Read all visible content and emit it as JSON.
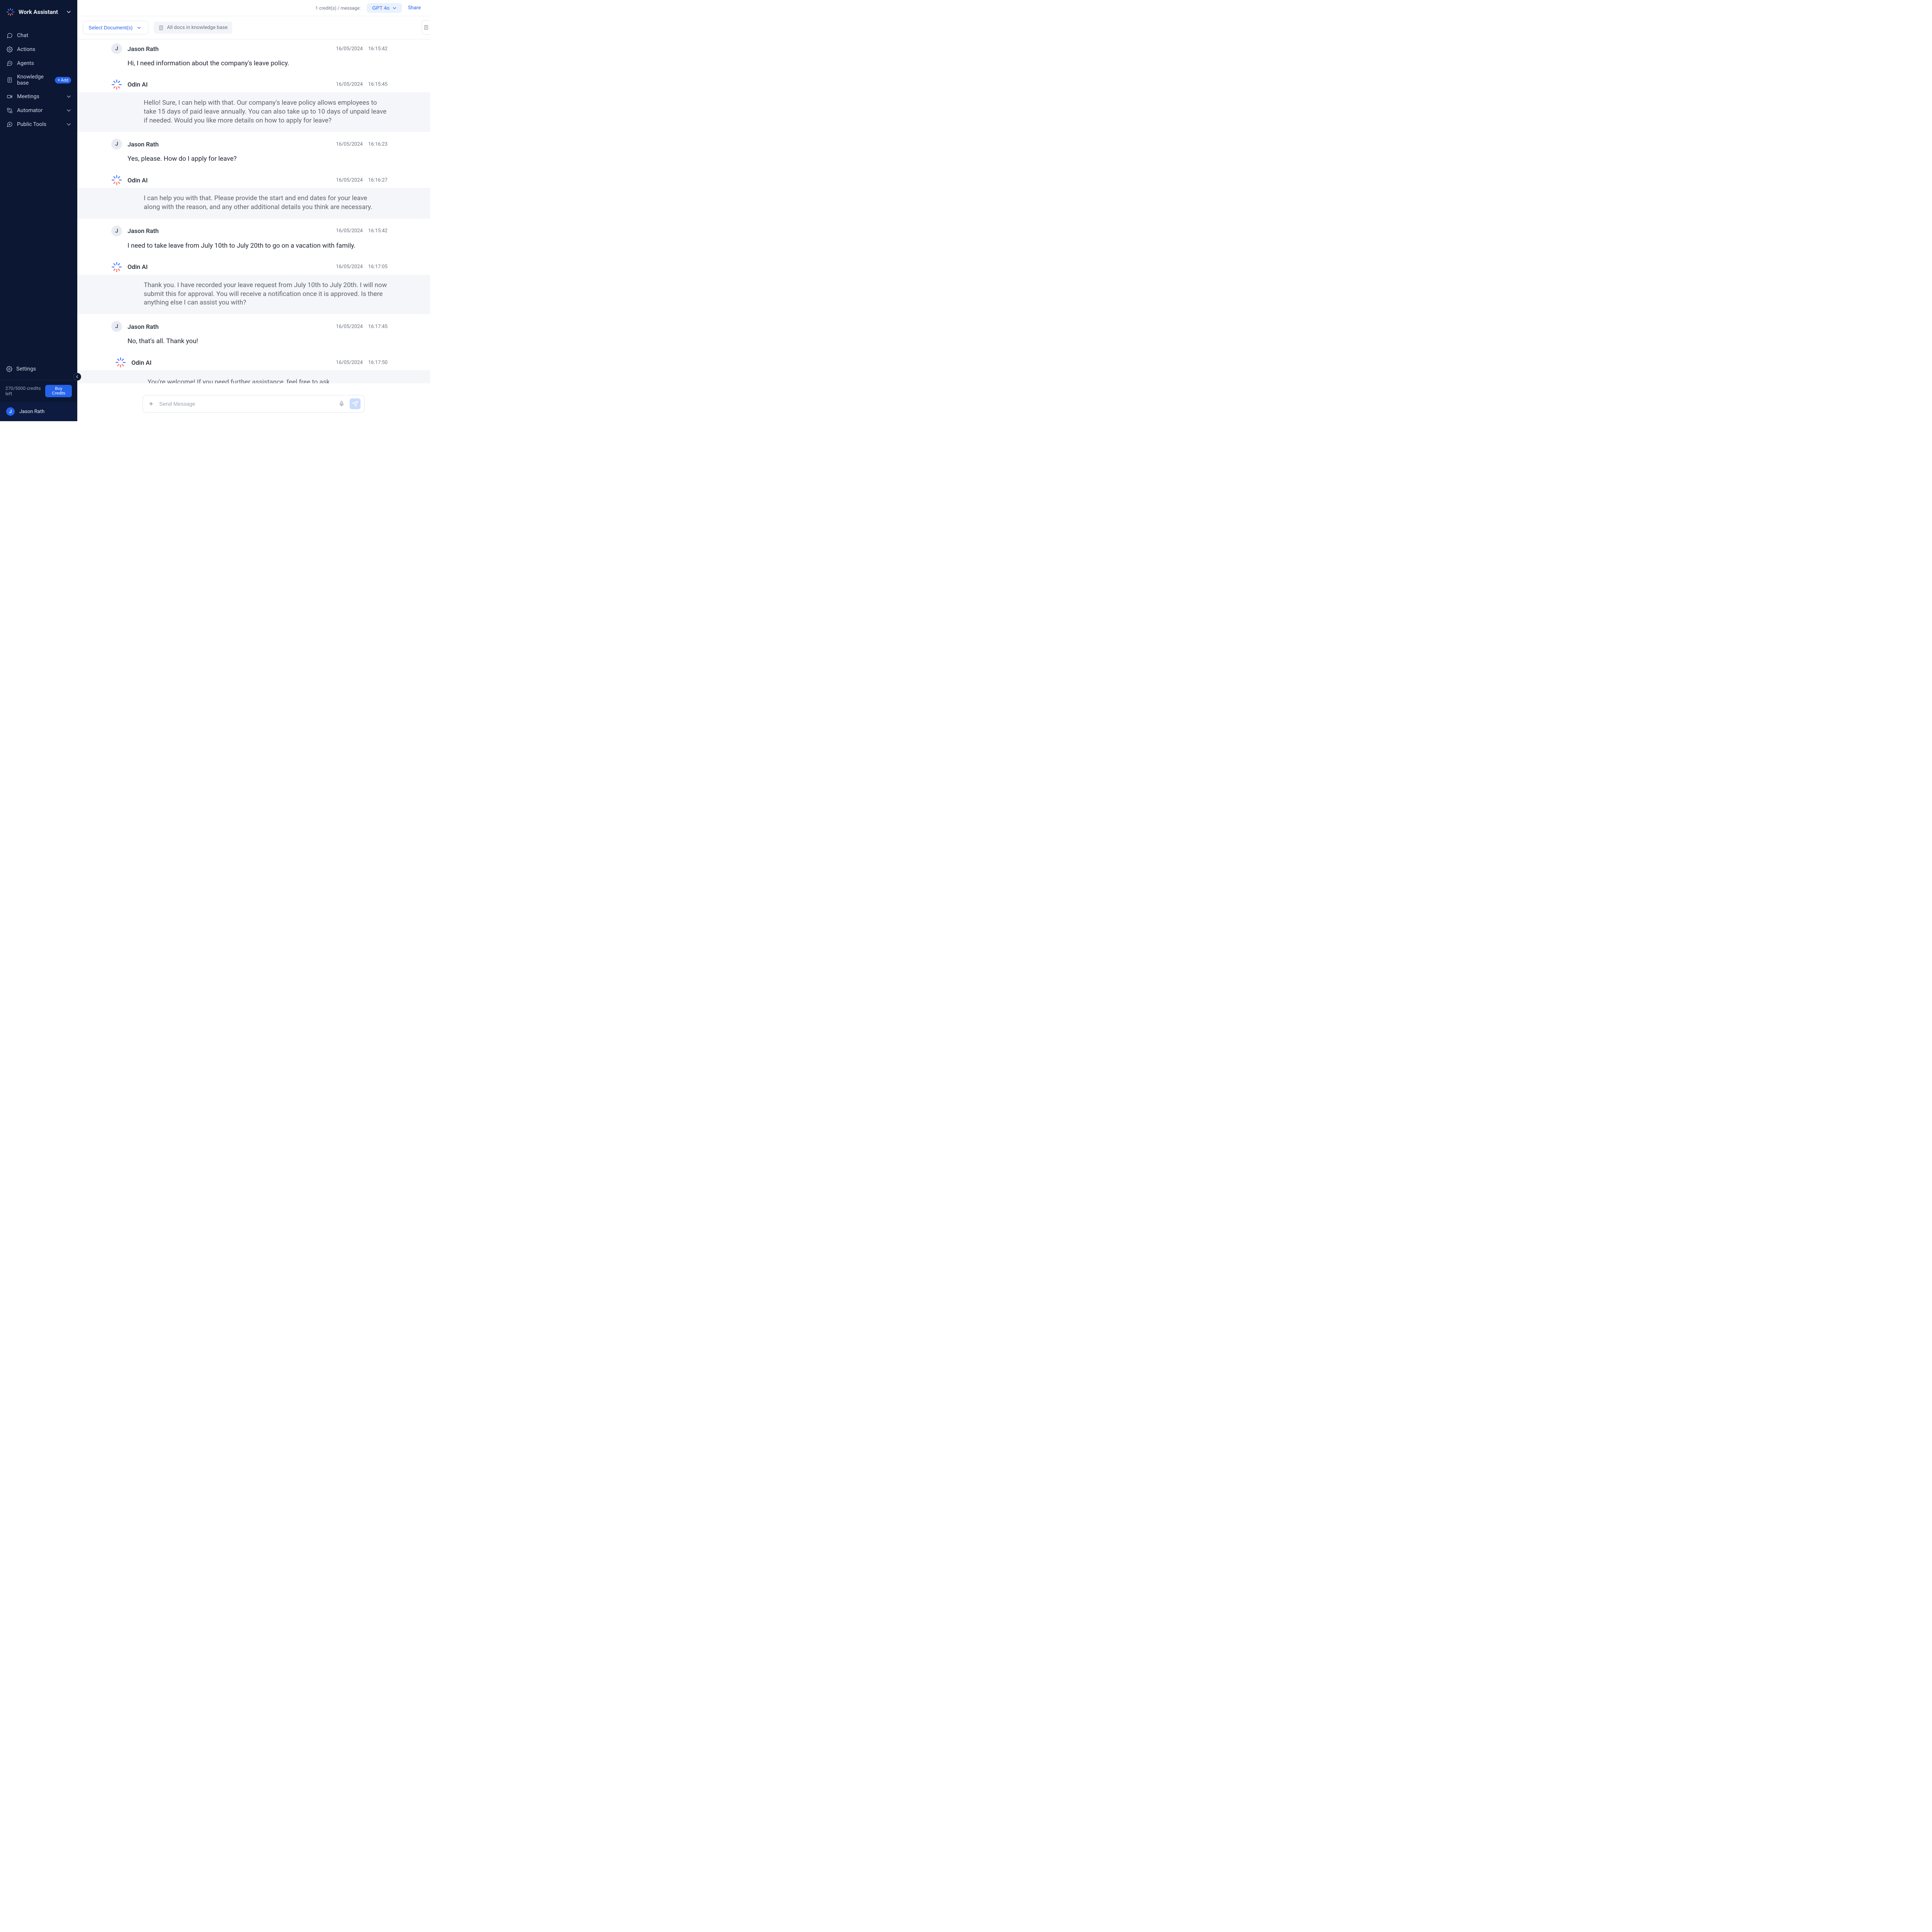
{
  "app": {
    "title": "Work Assistant"
  },
  "nav": {
    "chat": "Chat",
    "actions": "Actions",
    "agents": "Agents",
    "kb": "Knowledge base",
    "kb_add": "Add",
    "meetings": "Meetings",
    "automator": "Automator",
    "public_tools": "Public Tools"
  },
  "footer": {
    "settings": "Settings",
    "credits_left": "270/5000 credits left",
    "buy_credits": "Buy Credits",
    "user_name": "Jason Rath",
    "user_initial": "J"
  },
  "topbar": {
    "credits_msg": "1 credit(s) / message:",
    "model": "GPT 4o",
    "share": "Share"
  },
  "docbar": {
    "select": "Select Document(s)",
    "pill": "All docs in knowledge base"
  },
  "composer": {
    "placeholder": "Send Message"
  },
  "user": {
    "name": "Jason Rath",
    "initial": "J"
  },
  "ai": {
    "name": "Odin AI"
  },
  "messages": [
    {
      "role": "user",
      "date": "16/05/2024",
      "time": "16:15:42",
      "text": "Hi, I need information about the company's leave policy."
    },
    {
      "role": "ai",
      "date": "16/05/2024",
      "time": "16:15:45",
      "text": "Hello! Sure, I can help with that. Our company's leave policy allows employees to take 15 days of paid leave annually. You can also take up to 10 days of unpaid leave if needed. Would you like more details on how to apply for leave?"
    },
    {
      "role": "user",
      "date": "16/05/2024",
      "time": "16:16:23",
      "text": "Yes, please. How do I apply for leave?"
    },
    {
      "role": "ai",
      "date": "16/05/2024",
      "time": "16:16:27",
      "text": "I can help you with that. Please provide the start and end dates for your leave along with the reason, and any other additional details you think are necessary."
    },
    {
      "role": "user",
      "date": "16/05/2024",
      "time": "16:15:42",
      "text": "I need to take leave from July 10th to July 20th to go on a vacation with family."
    },
    {
      "role": "ai",
      "date": "16/05/2024",
      "time": "16:17:05",
      "text": "Thank you. I have recorded your leave request from July 10th to July 20th. I will now submit this for approval. You will receive a notification once it is approved. Is there anything else I can assist you with?"
    },
    {
      "role": "user",
      "date": "16/05/2024",
      "time": "16:17:45",
      "text": "No, that's all. Thank you!"
    },
    {
      "role": "ai",
      "date": "16/05/2024",
      "time": "16:17:50",
      "text": "You're welcome! If you need further assistance, feel free to ask."
    }
  ]
}
